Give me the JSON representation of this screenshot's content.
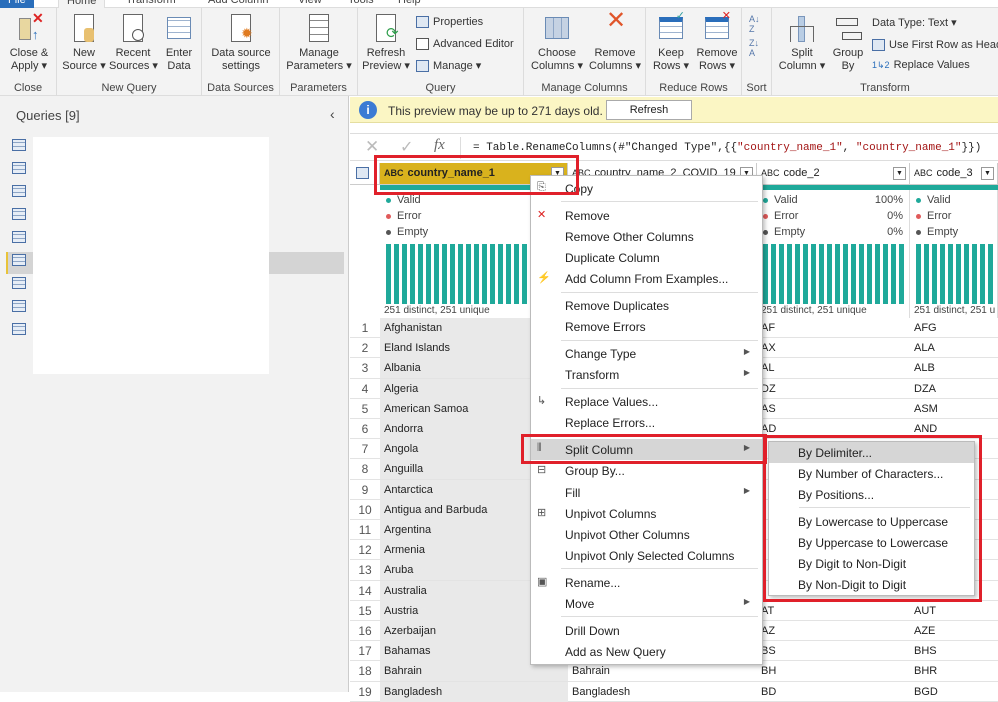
{
  "tabs": [
    "File",
    "Home",
    "Transform",
    "Add Column",
    "View",
    "Tools",
    "Help"
  ],
  "ribbon": {
    "close_apply": "Close &\nApply ▾",
    "new_source": "New\nSource ▾",
    "recent_sources": "Recent\nSources ▾",
    "enter_data": "Enter\nData",
    "data_source_settings": "Data source\nsettings",
    "manage_parameters": "Manage\nParameters ▾",
    "refresh_preview": "Refresh\nPreview ▾",
    "properties": "Properties",
    "advanced_editor": "Advanced Editor",
    "manage": "Manage ▾",
    "choose_columns": "Choose\nColumns ▾",
    "remove_columns": "Remove\nColumns ▾",
    "keep_rows": "Keep\nRows ▾",
    "remove_rows": "Remove\nRows ▾",
    "split_column": "Split\nColumn ▾",
    "group_by": "Group\nBy",
    "data_type": "Data Type: Text ▾",
    "use_first_row": "Use First Row as Headers ▾",
    "replace_values": "Replace Values",
    "groups": {
      "close": "Close",
      "new_query": "New Query",
      "data_sources": "Data Sources",
      "parameters": "Parameters",
      "query": "Query",
      "manage_columns": "Manage Columns",
      "reduce_rows": "Reduce Rows",
      "sort": "Sort",
      "transform": "Transform"
    }
  },
  "queries": {
    "title": "Queries [9]",
    "count": 9,
    "selected_index": 5
  },
  "info": {
    "message": "This preview may be up to 271 days old.",
    "refresh": "Refresh"
  },
  "formula": {
    "prefix": "= Table.RenameColumns(#\"Changed Type\",{{",
    "s1": "\"country_name_1\"",
    "mid": ", ",
    "s2": "\"country_name_1\"",
    "suffix": "}})"
  },
  "columns": [
    {
      "name": "country_name_1",
      "type": "ABC",
      "selected": true,
      "valid": "",
      "error": "",
      "empty": "",
      "distinct": "251 distinct, 251 unique"
    },
    {
      "name": "country_name_2_COVID_19",
      "type": "ABC",
      "valid": "",
      "error": "",
      "empty": "",
      "distinct": ""
    },
    {
      "name": "code_2",
      "type": "ABC",
      "valid": "100%",
      "error": "0%",
      "empty": "0%",
      "distinct": "251 distinct, 251 unique"
    },
    {
      "name": "code_3",
      "type": "ABC",
      "valid": "",
      "error": "",
      "empty": "",
      "distinct": "251 distinct, 251 u"
    }
  ],
  "profile_labels": {
    "valid": "Valid",
    "error": "Error",
    "empty": "Empty"
  },
  "rows": [
    [
      "1",
      "Afghanistan",
      "",
      "AF",
      "AFG"
    ],
    [
      "2",
      "Eland Islands",
      "",
      "AX",
      "ALA"
    ],
    [
      "3",
      "Albania",
      "",
      "AL",
      "ALB"
    ],
    [
      "4",
      "Algeria",
      "",
      "DZ",
      "DZA"
    ],
    [
      "5",
      "American Samoa",
      "",
      "AS",
      "ASM"
    ],
    [
      "6",
      "Andorra",
      "",
      "AD",
      "AND"
    ],
    [
      "7",
      "Angola",
      "",
      "",
      ""
    ],
    [
      "8",
      "Anguilla",
      "",
      "",
      ""
    ],
    [
      "9",
      "Antarctica",
      "",
      "",
      ""
    ],
    [
      "10",
      "Antigua and Barbuda",
      "",
      "",
      ""
    ],
    [
      "11",
      "Argentina",
      "",
      "",
      ""
    ],
    [
      "12",
      "Armenia",
      "",
      "",
      ""
    ],
    [
      "13",
      "Aruba",
      "",
      "",
      ""
    ],
    [
      "14",
      "Australia",
      "",
      "",
      ""
    ],
    [
      "15",
      "Austria",
      "",
      "AT",
      "AUT"
    ],
    [
      "16",
      "Azerbaijan",
      "",
      "AZ",
      "AZE"
    ],
    [
      "17",
      "Bahamas",
      "",
      "BS",
      "BHS"
    ],
    [
      "18",
      "Bahrain",
      "Bahrain",
      "BH",
      "BHR"
    ],
    [
      "19",
      "Bangladesh",
      "Bangladesh",
      "BD",
      "BGD"
    ]
  ],
  "context_menu": [
    {
      "label": "Copy",
      "icon": "copy-icon"
    },
    {
      "sep": true
    },
    {
      "label": "Remove",
      "icon": "remove-icon"
    },
    {
      "label": "Remove Other Columns"
    },
    {
      "label": "Duplicate Column"
    },
    {
      "label": "Add Column From Examples...",
      "icon": "examples-icon"
    },
    {
      "sep": true
    },
    {
      "label": "Remove Duplicates"
    },
    {
      "label": "Remove Errors"
    },
    {
      "sep": true
    },
    {
      "label": "Change Type",
      "submenu": true
    },
    {
      "label": "Transform",
      "submenu": true
    },
    {
      "sep": true
    },
    {
      "label": "Replace Values...",
      "icon": "replace-icon"
    },
    {
      "label": "Replace Errors..."
    },
    {
      "sep": true
    },
    {
      "label": "Split Column",
      "submenu": true,
      "highlighted": true,
      "icon": "split-icon"
    },
    {
      "label": "Group By...",
      "icon": "group-icon"
    },
    {
      "label": "Fill",
      "submenu": true
    },
    {
      "label": "Unpivot Columns",
      "icon": "unpivot-icon"
    },
    {
      "label": "Unpivot Other Columns"
    },
    {
      "label": "Unpivot Only Selected Columns"
    },
    {
      "sep": true
    },
    {
      "label": "Rename...",
      "icon": "rename-icon"
    },
    {
      "label": "Move",
      "submenu": true
    },
    {
      "sep": true
    },
    {
      "label": "Drill Down"
    },
    {
      "label": "Add as New Query"
    }
  ],
  "split_submenu": [
    {
      "label": "By Delimiter...",
      "highlighted": true
    },
    {
      "label": "By Number of Characters..."
    },
    {
      "label": "By Positions..."
    },
    {
      "sep": true
    },
    {
      "label": "By Lowercase to Uppercase"
    },
    {
      "label": "By Uppercase to Lowercase"
    },
    {
      "label": "By Digit to Non-Digit"
    },
    {
      "label": "By Non-Digit to Digit"
    }
  ],
  "colors": {
    "accent": "#d9b21d",
    "quality_bar": "#1fa99a",
    "highlight_box": "#e0202a",
    "info_bg": "#fbf6c4"
  }
}
